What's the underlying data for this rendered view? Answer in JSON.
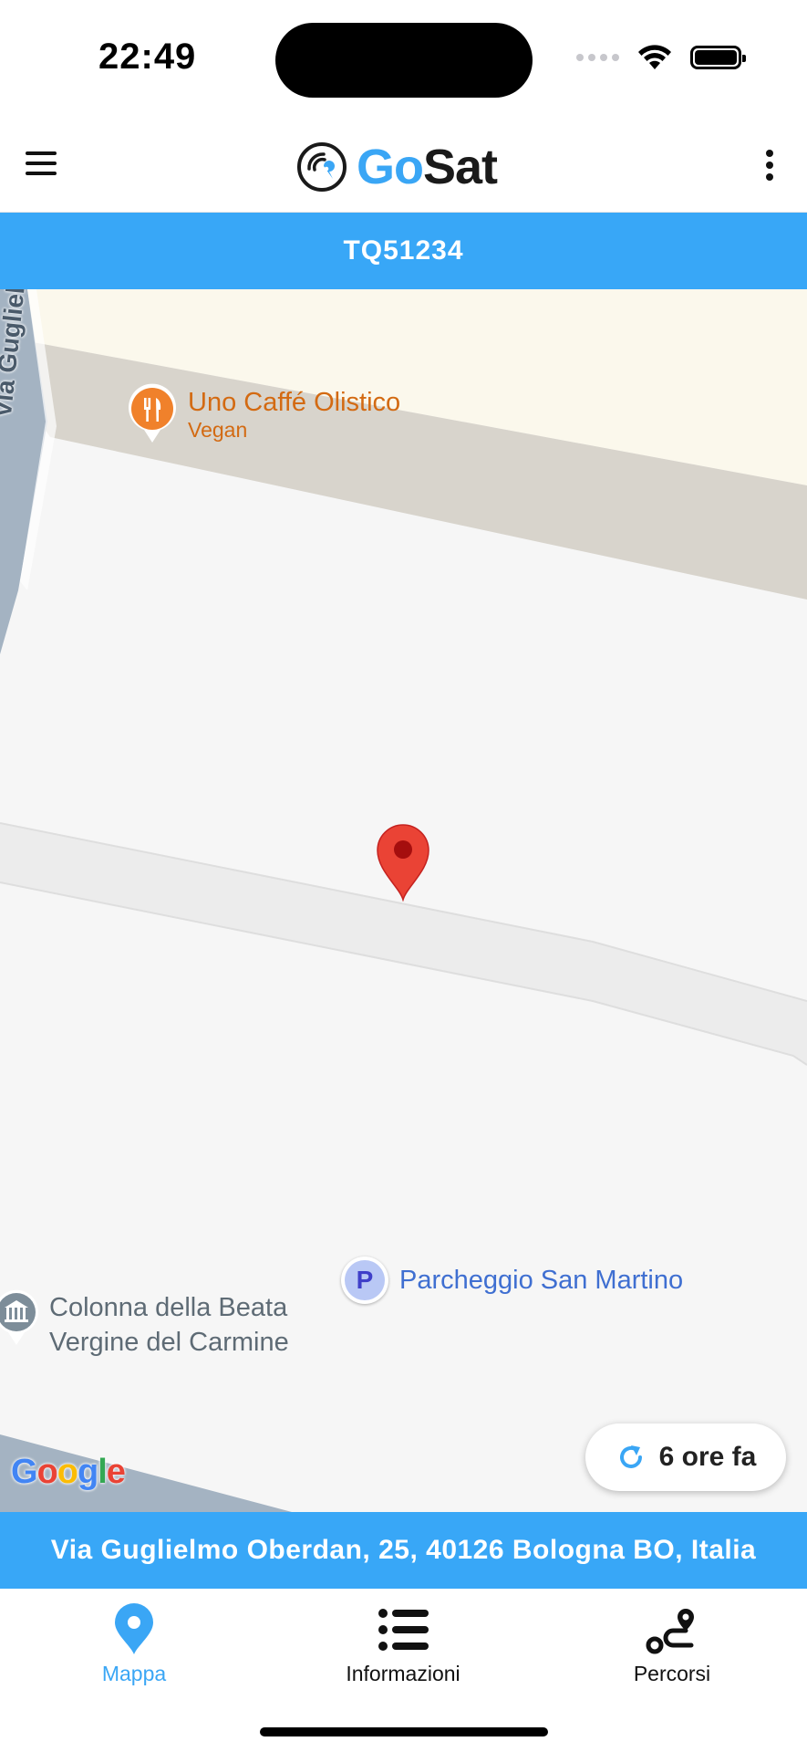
{
  "status_bar": {
    "time": "22:49"
  },
  "header": {
    "logo_go": "Go",
    "logo_sat": "Sat"
  },
  "vehicle": {
    "plate": "TQ51234"
  },
  "map": {
    "road_label": "Via Guglielmo",
    "pois": {
      "cafe": {
        "name": "Uno Caffé Olistico",
        "subtitle": "Vegan"
      },
      "parking": {
        "name": "Parcheggio San Martino",
        "badge": "P"
      },
      "monument": {
        "line1": "Colonna della Beata",
        "line2": "Vergine del Carmine"
      }
    },
    "attribution": "Google",
    "last_update": "6 ore fa"
  },
  "address": "Via Guglielmo Oberdan, 25, 40126 Bologna BO, Italia",
  "tabs": [
    {
      "label": "Mappa",
      "icon": "map-pin-icon",
      "active": true
    },
    {
      "label": "Informazioni",
      "icon": "list-icon",
      "active": false
    },
    {
      "label": "Percorsi",
      "icon": "route-icon",
      "active": false
    }
  ],
  "colors": {
    "accent": "#38a7f7",
    "marker": "#ea4335",
    "poi_food": "#f0812b",
    "poi_parking": "#3f6fd1"
  }
}
